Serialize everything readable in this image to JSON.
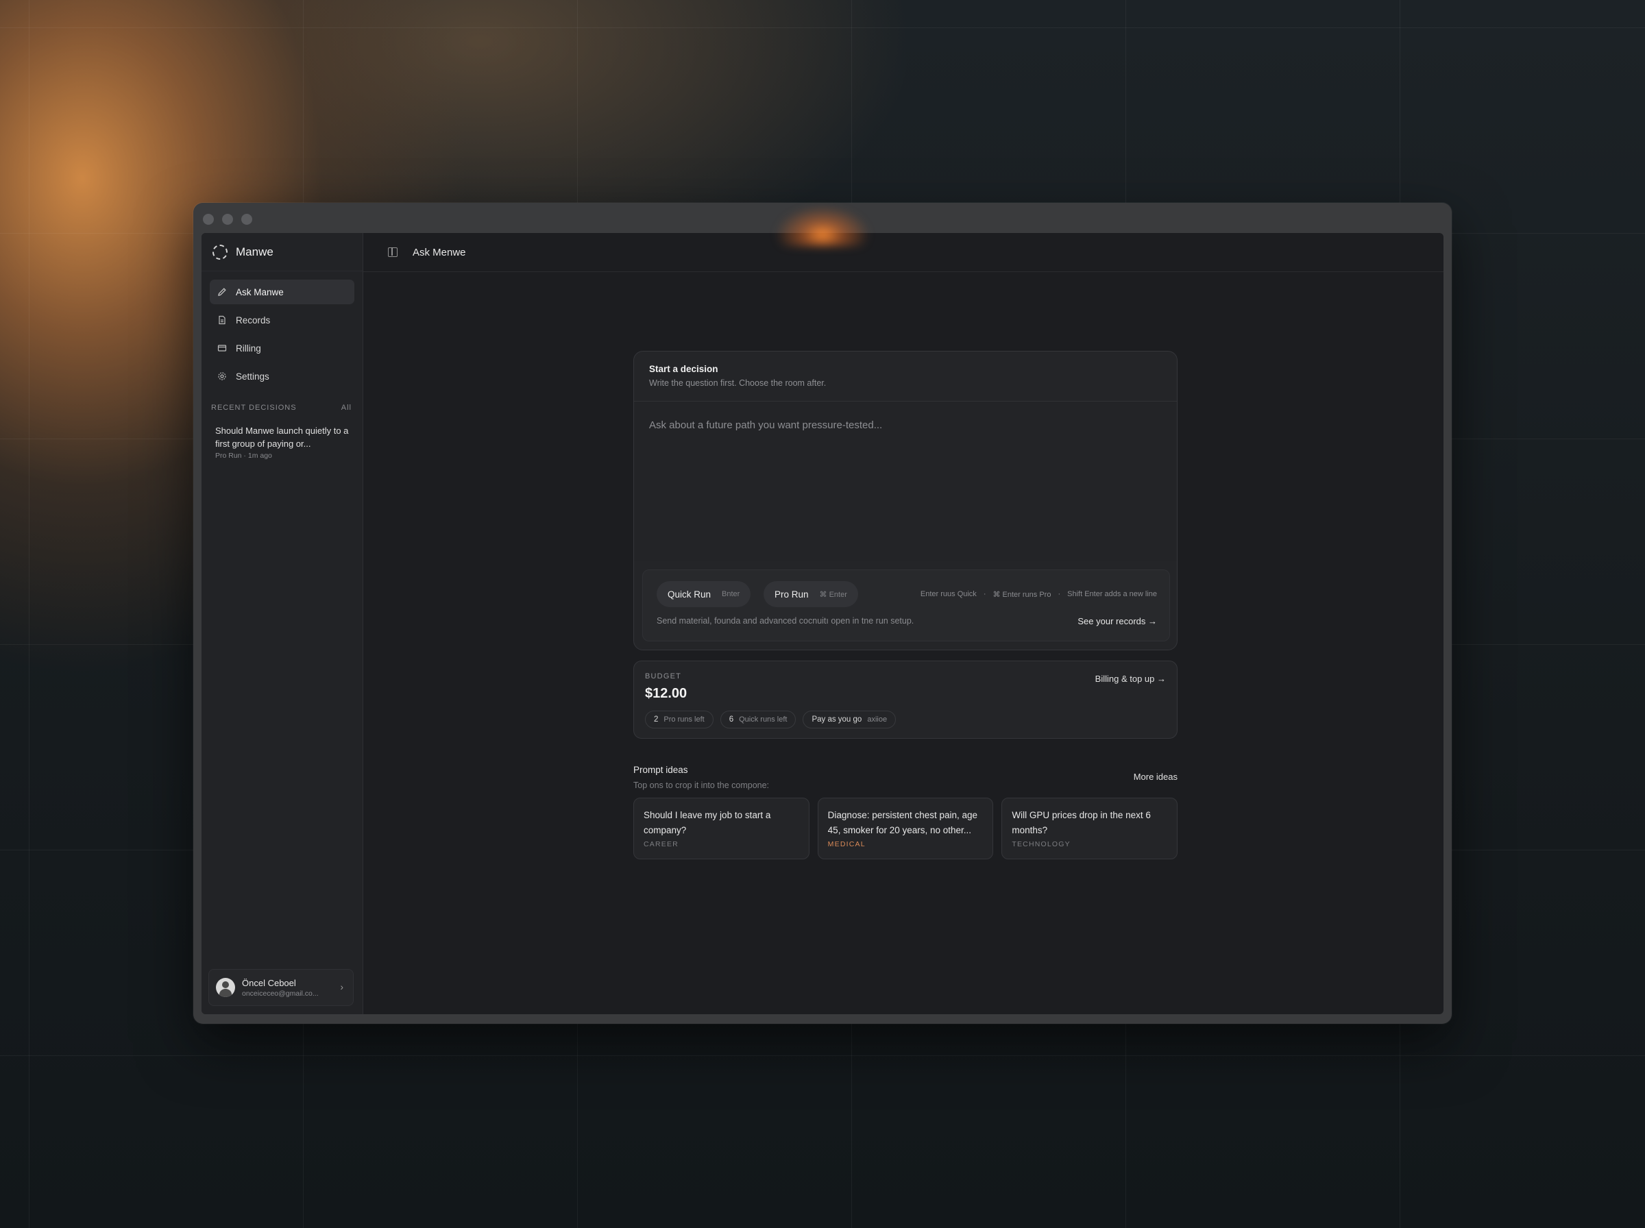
{
  "app": {
    "name": "Manwe"
  },
  "sidebar": {
    "items": [
      {
        "label": "Ask Manwe",
        "icon": "pen-icon",
        "active": true
      },
      {
        "label": "Records",
        "icon": "document-icon",
        "active": false
      },
      {
        "label": "Rilling",
        "icon": "card-icon",
        "active": false
      },
      {
        "label": "Settings",
        "icon": "gear-icon",
        "active": false
      }
    ],
    "recent_heading": "RECENT DECISIONS",
    "recent_all": "All",
    "recent": [
      {
        "title": "Should Manwe launch quietly to a first group of paying or...",
        "meta": "Pro Run · 1m ago"
      }
    ],
    "user": {
      "name": "Öncel Ceboel",
      "email": "onceiceceo@gmail.co...",
      "chevron": "›"
    }
  },
  "topbar": {
    "title": "Ask Menwe"
  },
  "composer": {
    "title": "Start a decision",
    "subtitle": "Write the question first. Choose the room after.",
    "placeholder": "Ask about a future path you want pressure-tested...",
    "quick_run": {
      "label": "Quick Run",
      "key": "Bnter"
    },
    "pro_run": {
      "label": "Pro Run",
      "key": "⌘ Enter"
    },
    "hints": [
      "Enter ruus Quick",
      "·",
      "⌘ Enter runs Pro",
      "·",
      "Shift Enter adds a new line"
    ],
    "note": "Send material, founda and advanced cocnuitı open in tne run setup.",
    "records_link": "See your records →"
  },
  "budget": {
    "label": "BUDGET",
    "amount": "$12.00",
    "link": "Billing & top up →",
    "chips": [
      {
        "value": "2",
        "text": "Pro runs left"
      },
      {
        "value": "6",
        "text": "Quick runs left"
      },
      {
        "value": "Pay as you go",
        "text": "axiioe"
      }
    ]
  },
  "ideas": {
    "title": "Prompt ideas",
    "subtitle": "Top ons to crop it into the compone:",
    "more": "More ideas",
    "cards": [
      {
        "text": "Should I leave my job to start a company?",
        "tag": "CAREER"
      },
      {
        "text": "Diagnose: persistent chest pain, age 45, smoker for 20 years, no other...",
        "tag": "MEDICAL"
      },
      {
        "text": "Will GPU prices drop in the next 6 months?",
        "tag": "TECHNOLOGY"
      }
    ]
  }
}
